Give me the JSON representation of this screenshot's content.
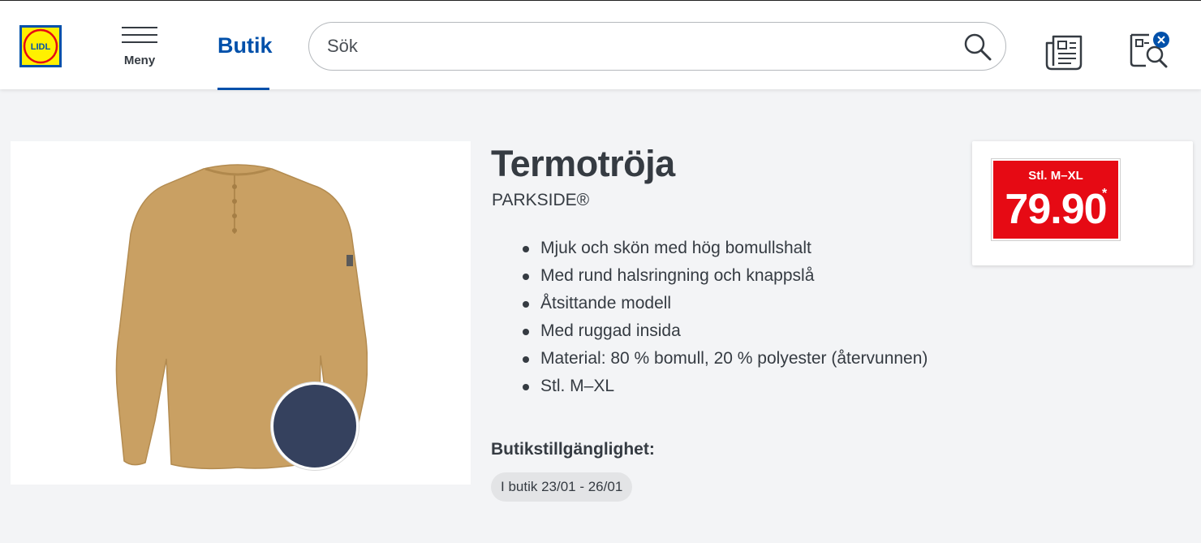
{
  "header": {
    "logo_text": "LIDL",
    "menu_label": "Meny",
    "active_tab": "Butik",
    "search_placeholder": "Sök",
    "icons": [
      "lidl-logo",
      "hamburger-menu-icon",
      "search-icon",
      "flyer-icon",
      "shopping-list-icon"
    ]
  },
  "product": {
    "title": "Termotröja",
    "brand": "PARKSIDE®",
    "features": [
      "Mjuk och skön med hög bomullshalt",
      "Med rund halsringning och knappslå",
      "Åtsittande modell",
      "Med ruggad insida",
      "Material: 80 % bomull, 20 % polyester (återvunnen)",
      "Stl. M–XL"
    ],
    "availability_title": "Butikstillgänglighet:",
    "availability_chip": "I butik 23/01 - 26/01"
  },
  "price": {
    "size_label": "Stl. M–XL",
    "value": "79.90",
    "asterisk": "*"
  },
  "colors": {
    "brand_blue": "#0050aa",
    "brand_yellow": "#fff000",
    "price_red": "#e60a14",
    "shirt_color": "#c9a063",
    "swatch_navy": "#35415e"
  }
}
